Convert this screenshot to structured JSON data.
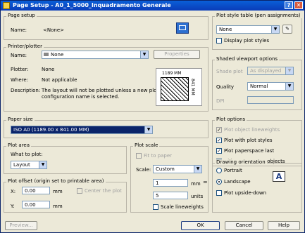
{
  "window": {
    "title": "Page Setup - A0_1_5000_Inquadramento Generale"
  },
  "page_setup": {
    "group": "Page setup",
    "name_label": "Name:",
    "name_value": "<None>"
  },
  "printer": {
    "group": "Printer/plotter",
    "name_label": "Name:",
    "name_value": "None",
    "properties_label": "Properties",
    "plotter_label": "Plotter:",
    "plotter_value": "None",
    "where_label": "Where:",
    "where_value": "Not applicable",
    "description_label": "Description:",
    "description_line1": "The layout will not be plotted unless a new plotter",
    "description_line2": "configuration name is selected.",
    "preview_width": "1189 MM",
    "preview_height": "841 MM"
  },
  "paper_size": {
    "group": "Paper size",
    "value": "ISO A0 (1189.00 x 841.00 MM)"
  },
  "plot_area": {
    "group": "Plot area",
    "what_label": "What to plot:",
    "value": "Layout"
  },
  "plot_offset": {
    "group": "Plot offset (origin set to printable area)",
    "x_label": "X:",
    "x_value": "0.00",
    "x_unit": "mm",
    "y_label": "Y:",
    "y_value": "0.00",
    "y_unit": "mm",
    "center_label": "Center the plot"
  },
  "plot_scale": {
    "group": "Plot scale",
    "fit_label": "Fit to paper",
    "scale_label": "Scale:",
    "scale_value": "Custom",
    "val1": "1",
    "unit1": "mm",
    "val2": "5",
    "unit2": "units",
    "lineweights_label": "Scale lineweights"
  },
  "plot_style": {
    "group": "Plot style table (pen assignments)",
    "value": "None",
    "display_label": "Display plot styles"
  },
  "shaded": {
    "group": "Shaded viewport options",
    "shade_label": "Shade plot",
    "shade_value": "As displayed",
    "quality_label": "Quality",
    "quality_value": "Normal",
    "dpi_label": "DPI"
  },
  "plot_options": {
    "group": "Plot options",
    "opt1": "Plot object lineweights",
    "opt2": "Plot with plot styles",
    "opt3": "Plot paperspace last",
    "opt4": "Hide paperspace objects"
  },
  "orientation": {
    "group": "Drawing orientation",
    "portrait": "Portrait",
    "landscape": "Landscape",
    "upside": "Plot upside-down",
    "icon_letter": "A"
  },
  "buttons": {
    "preview": "Preview...",
    "ok": "OK",
    "cancel": "Cancel",
    "help": "Help"
  }
}
